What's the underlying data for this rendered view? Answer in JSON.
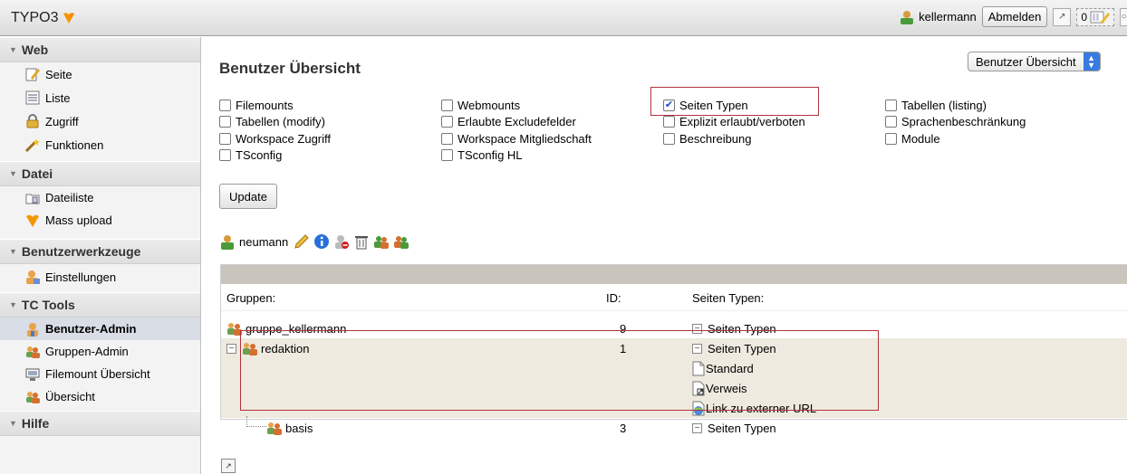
{
  "topbar": {
    "logo_text": "TYPO3",
    "username": "kellermann",
    "logout_label": "Abmelden",
    "counter": "0"
  },
  "sidebar": {
    "sections": [
      {
        "title": "Web",
        "items": [
          {
            "label": "Seite",
            "icon": "page-edit-icon"
          },
          {
            "label": "Liste",
            "icon": "list-icon"
          },
          {
            "label": "Zugriff",
            "icon": "lock-icon"
          },
          {
            "label": "Funktionen",
            "icon": "wand-icon"
          }
        ]
      },
      {
        "title": "Datei",
        "items": [
          {
            "label": "Dateiliste",
            "icon": "filelist-icon"
          },
          {
            "label": "Mass upload",
            "icon": "typo3-logo-icon"
          }
        ]
      },
      {
        "title": "Benutzerwerkzeuge",
        "items": [
          {
            "label": "Einstellungen",
            "icon": "user-settings-icon"
          }
        ]
      },
      {
        "title": "TC Tools",
        "items": [
          {
            "label": "Benutzer-Admin",
            "icon": "user-admin-icon",
            "active": true
          },
          {
            "label": "Gruppen-Admin",
            "icon": "group-icon"
          },
          {
            "label": "Filemount Übersicht",
            "icon": "filemount-icon"
          },
          {
            "label": "Übersicht",
            "icon": "group-icon"
          }
        ]
      },
      {
        "title": "Hilfe",
        "items": []
      }
    ]
  },
  "main": {
    "title": "Benutzer Übersicht",
    "view_select": "Benutzer Übersicht",
    "checkboxes": [
      {
        "label": "Filemounts",
        "checked": false
      },
      {
        "label": "Webmounts",
        "checked": false
      },
      {
        "label": "Seiten Typen",
        "checked": true
      },
      {
        "label": "Tabellen (listing)",
        "checked": false
      },
      {
        "label": "Tabellen (modify)",
        "checked": false
      },
      {
        "label": "Erlaubte Excludefelder",
        "checked": false
      },
      {
        "label": "Explizit erlaubt/verboten",
        "checked": false
      },
      {
        "label": "Sprachenbeschränkung",
        "checked": false
      },
      {
        "label": "Workspace Zugriff",
        "checked": false
      },
      {
        "label": "Workspace Mitgliedschaft",
        "checked": false
      },
      {
        "label": "Beschreibung",
        "checked": false
      },
      {
        "label": "Module",
        "checked": false
      },
      {
        "label": "TSconfig",
        "checked": false
      },
      {
        "label": "TSconfig HL",
        "checked": false
      }
    ],
    "update_label": "Update",
    "user": "neumann",
    "table": {
      "col_groups": "Gruppen:",
      "col_id": "ID:",
      "col_types": "Seiten Typen:",
      "rows": [
        {
          "name": "gruppe_kellermann",
          "id": "9",
          "types": "Seiten Typen"
        },
        {
          "name": "redaktion",
          "id": "1",
          "types": "Seiten Typen",
          "subtypes": [
            "Standard",
            "Verweis",
            "Link zu externer URL"
          ]
        },
        {
          "name": "basis",
          "id": "3",
          "types": "Seiten Typen"
        }
      ]
    }
  }
}
